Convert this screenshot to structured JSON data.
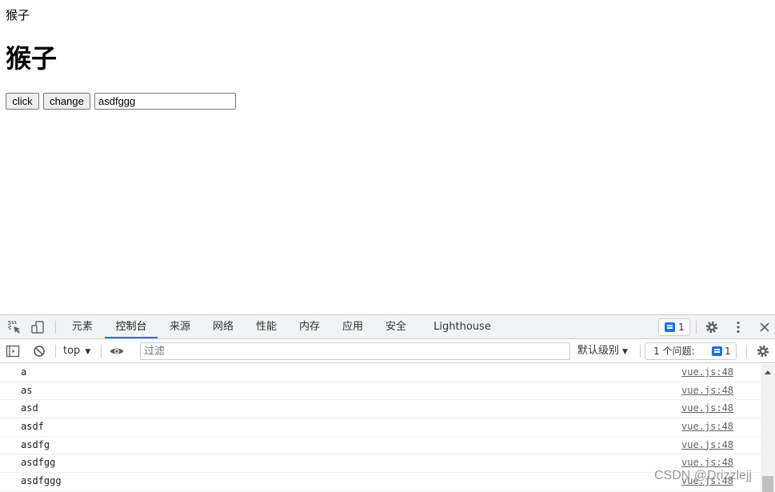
{
  "page": {
    "text": "猴子",
    "heading": "猴子",
    "click_button": "click",
    "change_button": "change",
    "input_value": "asdfggg"
  },
  "devtools": {
    "tabs": [
      {
        "label": "元素"
      },
      {
        "label": "控制台",
        "active": true
      },
      {
        "label": "来源"
      },
      {
        "label": "网络"
      },
      {
        "label": "性能"
      },
      {
        "label": "内存"
      },
      {
        "label": "应用"
      },
      {
        "label": "安全"
      },
      {
        "label": "Lighthouse"
      }
    ],
    "issues_badge_count": "1",
    "toolbar": {
      "context": "top",
      "filter_placeholder": "过滤",
      "level": "默认级别",
      "issues_label": "1 个问题:",
      "issues_count": "1"
    },
    "console": [
      {
        "message": "a",
        "source": "vue.js:48"
      },
      {
        "message": "as",
        "source": "vue.js:48"
      },
      {
        "message": "asd",
        "source": "vue.js:48"
      },
      {
        "message": "asdf",
        "source": "vue.js:48"
      },
      {
        "message": "asdfg",
        "source": "vue.js:48"
      },
      {
        "message": "asdfgg",
        "source": "vue.js:48"
      },
      {
        "message": "asdfggg",
        "source": "vue.js:48"
      }
    ],
    "accent_color": "#1a73e8"
  },
  "watermark": "CSDN @Drizzlejj"
}
